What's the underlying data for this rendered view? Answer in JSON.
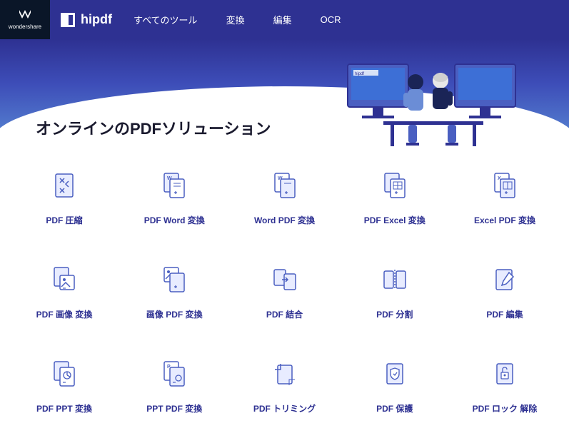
{
  "brand": {
    "parent": "wondershare",
    "name": "hipdf"
  },
  "nav": {
    "items": [
      "すべてのツール",
      "変換",
      "編集",
      "OCR"
    ]
  },
  "hero": {
    "title": "オンラインのPDFソリューション"
  },
  "tools": {
    "rows": [
      [
        {
          "id": "pdf-compress",
          "label": "PDF 圧縮"
        },
        {
          "id": "pdf-to-word",
          "label": "PDF Word 変換"
        },
        {
          "id": "word-to-pdf",
          "label": "Word PDF 変換"
        },
        {
          "id": "pdf-to-excel",
          "label": "PDF Excel 変換"
        },
        {
          "id": "excel-to-pdf",
          "label": "Excel PDF 変換"
        }
      ],
      [
        {
          "id": "pdf-to-image",
          "label": "PDF 画像 変換"
        },
        {
          "id": "image-to-pdf",
          "label": "画像 PDF 変換"
        },
        {
          "id": "pdf-merge",
          "label": "PDF 結合"
        },
        {
          "id": "pdf-split",
          "label": "PDF 分割"
        },
        {
          "id": "pdf-edit",
          "label": "PDF 編集"
        }
      ],
      [
        {
          "id": "pdf-to-ppt",
          "label": "PDF PPT 変換"
        },
        {
          "id": "ppt-to-pdf",
          "label": "PPT PDF 変換"
        },
        {
          "id": "pdf-crop",
          "label": "PDF トリミング"
        },
        {
          "id": "pdf-protect",
          "label": "PDF 保護"
        },
        {
          "id": "pdf-unlock",
          "label": "PDF ロック 解除"
        }
      ]
    ]
  }
}
